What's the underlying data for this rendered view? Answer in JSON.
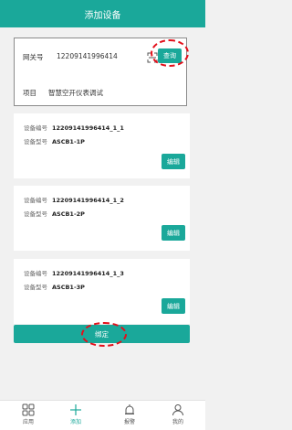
{
  "header": {
    "title": "添加设备"
  },
  "gateway": {
    "label": "网关号",
    "value": "12209141996414",
    "query_label": "查询",
    "project_label": "项目",
    "project_value": "智慧空开仪表调试"
  },
  "devices": [
    {
      "code_label": "设备编号",
      "code": "12209141996414_1_1",
      "model_label": "设备型号",
      "model": "ASCB1-1P",
      "edit_label": "编辑"
    },
    {
      "code_label": "设备编号",
      "code": "12209141996414_1_2",
      "model_label": "设备型号",
      "model": "ASCB1-2P",
      "edit_label": "编辑"
    },
    {
      "code_label": "设备编号",
      "code": "12209141996414_1_3",
      "model_label": "设备型号",
      "model": "ASCB1-3P",
      "edit_label": "编辑"
    }
  ],
  "bind_label": "绑定",
  "tabs": [
    {
      "label": "应用",
      "icon": "grid-icon"
    },
    {
      "label": "添加",
      "icon": "plus-icon"
    },
    {
      "label": "报警",
      "icon": "bell-icon"
    },
    {
      "label": "我的",
      "icon": "user-icon"
    }
  ],
  "colors": {
    "accent": "#1aa89a",
    "highlight": "#e30f1a"
  }
}
